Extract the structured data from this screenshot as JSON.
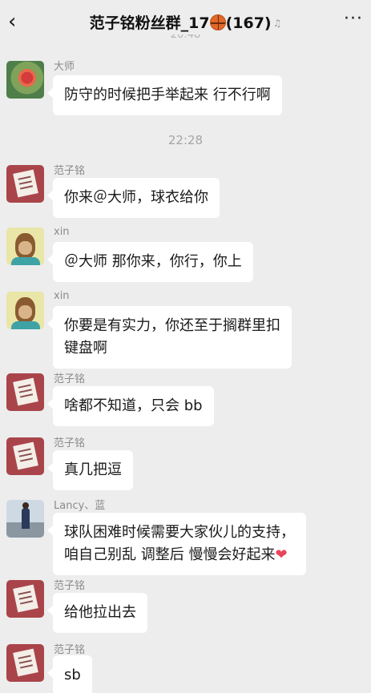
{
  "header": {
    "back_icon": "‹",
    "title": "范子铭粉丝群_17",
    "member_count": "(167)",
    "more_icon": "···"
  },
  "colors": {
    "background": "#ededed",
    "bubble": "#ffffff",
    "heart": "#e8455a"
  },
  "timestamps": {
    "top_clipped": "20:48",
    "mid": "22:28"
  },
  "messages": [
    {
      "sender": "大师",
      "text": "防守的时候把手举起来 行不行啊"
    },
    {
      "sender": "范子铭",
      "text": "你来＠大师，球衣给你"
    },
    {
      "sender": "xin",
      "text": "＠大师 那你来，你行，你上"
    },
    {
      "sender": "xin",
      "text_line1": "你要是有实力，你还至于搁群里扣",
      "text_line2": "键盘啊"
    },
    {
      "sender": "范子铭",
      "text": "啥都不知道，只会 bb"
    },
    {
      "sender": "范子铭",
      "text": "真几把逗"
    },
    {
      "sender": "Lancy、蓝",
      "text_line1": "球队困难时候需要大家伙儿的支持，",
      "text_line2": "咱自己别乱 调整后 慢慢会好起来"
    },
    {
      "sender": "范子铭",
      "text": "给他拉出去"
    },
    {
      "sender": "范子铭",
      "text": "sb"
    }
  ]
}
